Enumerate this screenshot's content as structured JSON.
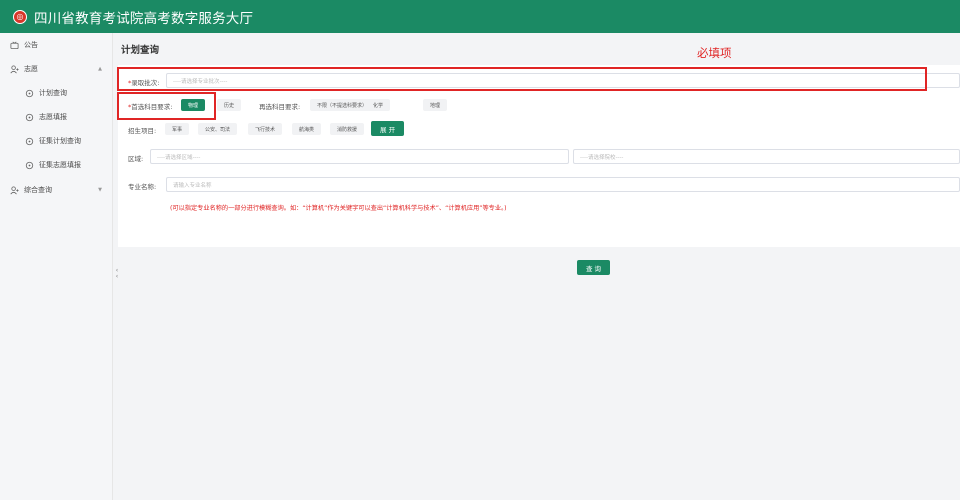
{
  "header": {
    "logo_icon": "emblem-icon",
    "title": "四川省教育考试院高考数字服务大厅"
  },
  "sidebar": {
    "items": [
      {
        "label": "公告",
        "icon": "notice-icon",
        "level": 1
      },
      {
        "label": "志愿",
        "icon": "user-volunteer-icon",
        "level": 1,
        "expanded": true
      },
      {
        "label": "计划查询",
        "icon": "circle-dot-icon",
        "level": 2
      },
      {
        "label": "志愿填报",
        "icon": "circle-dot-icon",
        "level": 2
      },
      {
        "label": "征集计划查询",
        "icon": "circle-dot-icon",
        "level": 2
      },
      {
        "label": "征集志愿填报",
        "icon": "circle-dot-icon",
        "level": 2
      },
      {
        "label": "综合查询",
        "icon": "user-query-icon",
        "level": 1,
        "expanded": false
      }
    ],
    "collapse_glyph": "‹‹"
  },
  "main": {
    "page_title": "计划查询",
    "required_note": "必填项",
    "batch": {
      "star": "*",
      "label": "录取批次:",
      "placeholder": "----请选择专业批次----"
    },
    "first_subject": {
      "star": "*",
      "label": "首选科目要求:",
      "options": [
        "物理",
        "历史"
      ],
      "selected": "物理"
    },
    "second_subject": {
      "label": "再选科目要求:",
      "options": [
        "不限（不提选科要求）",
        "化学",
        "地理"
      ]
    },
    "project": {
      "label": "招生项目:",
      "options": [
        "军事",
        "公安、司法",
        "飞行技术",
        "航海类",
        "消防救援"
      ],
      "expand_label": "展 开"
    },
    "region": {
      "label": "区域:",
      "placeholder": "----请选择区域----",
      "school_placeholder": "----请选择院校----"
    },
    "major": {
      "label": "专业名称:",
      "placeholder": "请输入专业名称"
    },
    "hint": "(可以指定专业名称的一部分进行模糊查询。如：“计算机”作为关键字可以查出“计算机科学与技术”、“计算机应用”等专业。)",
    "query_label": "查 询"
  },
  "colors": {
    "brand": "#1b8a64",
    "required": "#e02525",
    "background": "#f3f4f6"
  }
}
